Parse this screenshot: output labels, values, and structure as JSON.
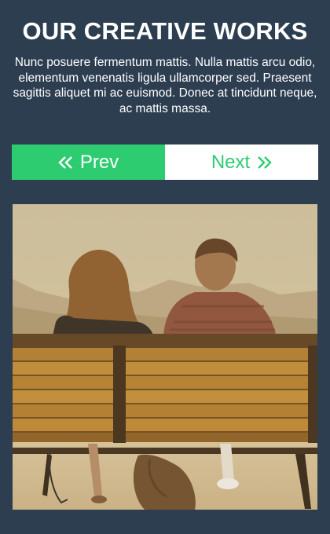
{
  "section": {
    "title": "OUR CREATIVE WORKS",
    "description": "Nunc posuere fermentum mattis. Nulla mattis arcu odio, elementum venenatis ligula ullamcorper sed. Praesent sagittis aliquet mi ac euismod. Donec at tincidunt neque, ac mattis massa."
  },
  "nav": {
    "prev_label": "Prev",
    "next_label": "Next",
    "prev_icon": "double-chevron-left-icon",
    "next_icon": "double-chevron-right-icon"
  },
  "colors": {
    "background": "#2c3e50",
    "accent": "#2ecc71",
    "text": "#ffffff"
  },
  "gallery": {
    "current_image": "couple-on-bench-photo"
  }
}
